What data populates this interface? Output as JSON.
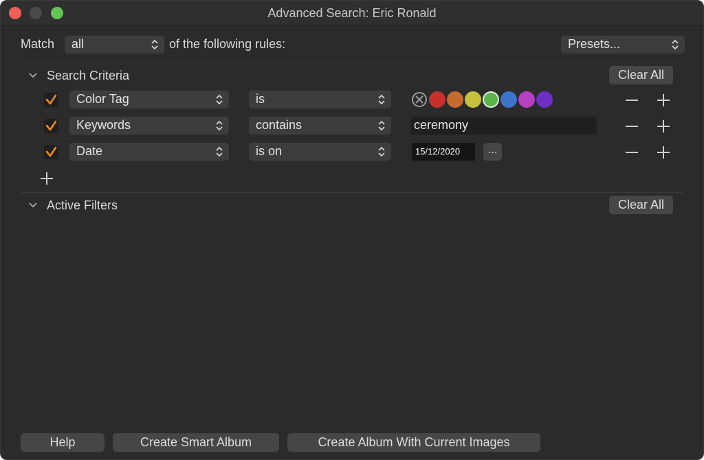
{
  "window": {
    "title": "Advanced Search: Eric Ronald"
  },
  "match": {
    "label": "Match",
    "value": "all",
    "suffix": "of the following rules:",
    "presets_label": "Presets..."
  },
  "search_criteria": {
    "title": "Search Criteria",
    "clear_all": "Clear All",
    "rules": [
      {
        "field": "Color Tag",
        "operator": "is",
        "checked": true
      },
      {
        "field": "Keywords",
        "operator": "contains",
        "value": "ceremony",
        "checked": true
      },
      {
        "field": "Date",
        "operator": "is on",
        "value": "15/12/2020",
        "more_label": "...",
        "checked": true
      }
    ],
    "color_tags": [
      {
        "name": "none",
        "color": "#2b2b2b"
      },
      {
        "name": "red",
        "color": "#c8312b"
      },
      {
        "name": "orange",
        "color": "#c56a30"
      },
      {
        "name": "yellow",
        "color": "#c6c03c"
      },
      {
        "name": "green",
        "color": "#5bb54a",
        "selected": true
      },
      {
        "name": "blue",
        "color": "#3c74c9"
      },
      {
        "name": "magenta",
        "color": "#b73fc2"
      },
      {
        "name": "purple",
        "color": "#6d2fc4"
      }
    ]
  },
  "active_filters": {
    "title": "Active Filters",
    "clear_all": "Clear All"
  },
  "footer": {
    "help": "Help",
    "create_smart_album": "Create Smart Album",
    "create_album_current": "Create Album With Current Images"
  },
  "colors": {
    "window_bg": "#2b2b2b",
    "accent_check": "#f08a24",
    "close": "#ee5f57",
    "maximize": "#62c554"
  }
}
